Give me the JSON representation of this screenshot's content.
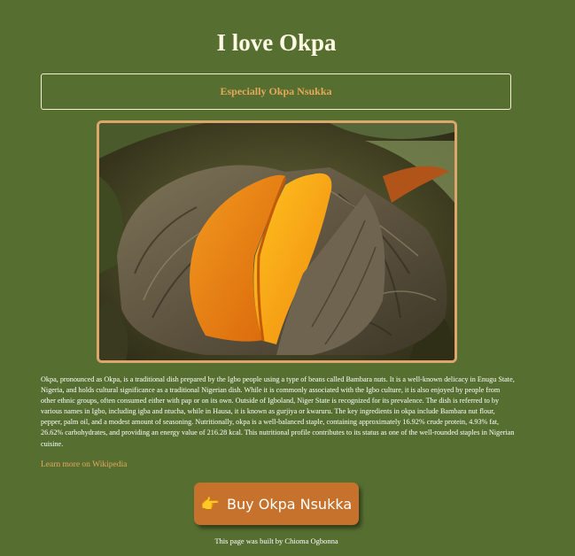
{
  "page": {
    "title": "I love Okpa",
    "subtitle": "Especially Okpa Nsukka",
    "background_color": "#566f31",
    "accent_color": "#e5a85b"
  },
  "image": {
    "alt": "Okpa wrapped in banana leaves"
  },
  "description": "Okpa, pronounced as Okpa, is a traditional dish prepared by the Igbo people using a type of beans called Bambara nuts. It is a well-known delicacy in Enugu State, Nigeria, and holds cultural significance as a traditional Nigerian dish. While it is commonly associated with the Igbo culture, it is also enjoyed by people from other ethnic groups, often consumed either with pap or on its own. Outside of Igboland, Niger State is recognized for its prevalence. The dish is referred to by various names in Igbo, including igba and ntucha, while in Hausa, it is known as gurjiya or kwaruru. The key ingredients in okpa include Bambara nut flour, pepper, palm oil, and a modest amount of seasoning. Nutritionally, okpa is a well-balanced staple, containing approximately 16.92% crude protein, 4.93% fat, 26.62% carbohydrates, and providing an energy value of 216.28 kcal. This nutritional profile contributes to its status as one of the well-rounded staples in Nigerian cuisine.",
  "wiki_link": "Learn more on Wikipedia",
  "buy_button": {
    "label": "Buy Okpa Nsukka",
    "icon": "pointing-hand-icon",
    "color": "#c6712c"
  },
  "footer": "This page was built by Chioma Ogbonna"
}
